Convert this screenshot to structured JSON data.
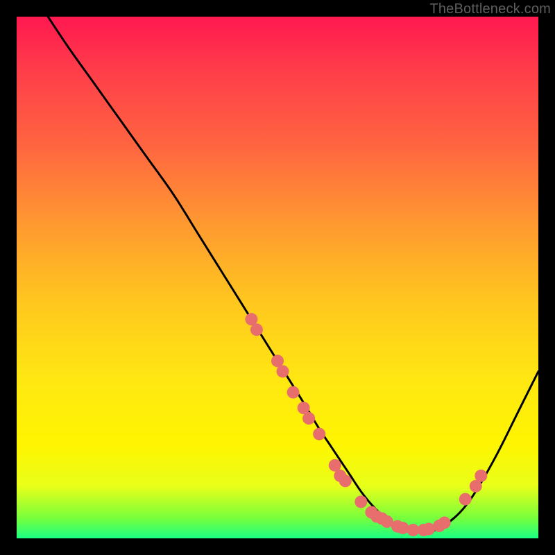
{
  "watermark": "TheBottleneck.com",
  "colors": {
    "curve": "#000000",
    "marker_fill": "#e86d6d",
    "marker_stroke": "#c94f4f",
    "gradient_top": "#ff1850",
    "gradient_bottom": "#1aff84"
  },
  "chart_data": {
    "type": "line",
    "title": "",
    "subtitle": "",
    "xlabel": "",
    "ylabel": "",
    "xlim": [
      0,
      100
    ],
    "ylim": [
      0,
      100
    ],
    "grid": false,
    "legend": false,
    "series": [
      {
        "name": "bottleneck-curve",
        "x": [
          6,
          10,
          15,
          20,
          25,
          30,
          35,
          40,
          45,
          50,
          55,
          58,
          60,
          62,
          64,
          66,
          68,
          70,
          72,
          74,
          76,
          78,
          80,
          82,
          85,
          88,
          92,
          96,
          100
        ],
        "y": [
          100,
          94,
          87,
          80,
          73,
          66,
          58,
          50,
          42,
          34,
          26,
          21,
          18,
          15,
          12,
          9,
          6.5,
          4.5,
          3,
          2,
          1.5,
          1.2,
          1.5,
          2.5,
          5,
          9,
          16,
          24,
          32
        ]
      }
    ],
    "markers": [
      {
        "x": 45,
        "y": 42
      },
      {
        "x": 46,
        "y": 40
      },
      {
        "x": 50,
        "y": 34
      },
      {
        "x": 51,
        "y": 32
      },
      {
        "x": 53,
        "y": 28
      },
      {
        "x": 55,
        "y": 25
      },
      {
        "x": 56,
        "y": 23
      },
      {
        "x": 58,
        "y": 20
      },
      {
        "x": 61,
        "y": 14
      },
      {
        "x": 62,
        "y": 12
      },
      {
        "x": 63,
        "y": 11
      },
      {
        "x": 66,
        "y": 7
      },
      {
        "x": 68,
        "y": 5
      },
      {
        "x": 69,
        "y": 4.2
      },
      {
        "x": 70,
        "y": 3.8
      },
      {
        "x": 71,
        "y": 3.2
      },
      {
        "x": 73,
        "y": 2.3
      },
      {
        "x": 74,
        "y": 2.0
      },
      {
        "x": 76,
        "y": 1.6
      },
      {
        "x": 78,
        "y": 1.6
      },
      {
        "x": 79,
        "y": 1.8
      },
      {
        "x": 81,
        "y": 2.4
      },
      {
        "x": 82,
        "y": 3.0
      },
      {
        "x": 86,
        "y": 7.5
      },
      {
        "x": 88,
        "y": 10
      },
      {
        "x": 89,
        "y": 12
      }
    ]
  }
}
